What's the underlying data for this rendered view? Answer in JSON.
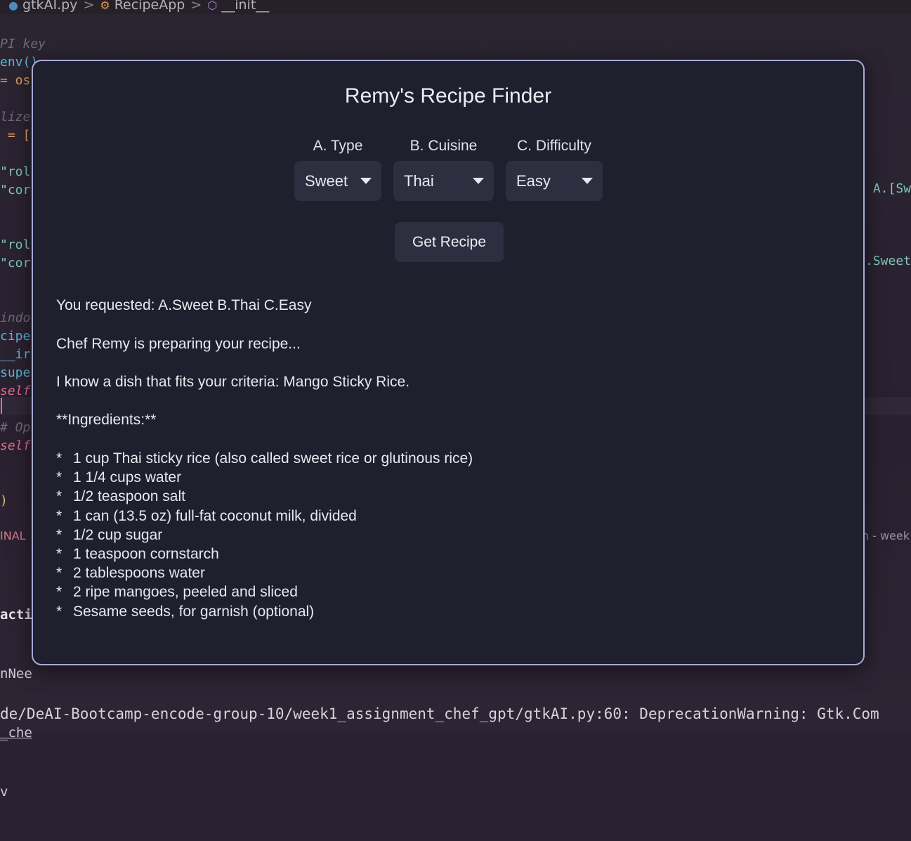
{
  "editor": {
    "breadcrumb": [
      "gtkAI.py",
      "RecipeApp",
      "__init__"
    ],
    "code_lines": [
      {
        "text": "PI key",
        "cls": "c-comment"
      },
      {
        "text": "env()",
        "cls": "c-fn"
      },
      {
        "text": "= os",
        "cls": "c-op"
      },
      {
        "text": "",
        "cls": ""
      },
      {
        "text": "lize",
        "cls": "c-comment"
      },
      {
        "text": " = [",
        "cls": "c-op"
      },
      {
        "text": "",
        "cls": ""
      },
      {
        "text": "\"rol",
        "cls": "c-str"
      },
      {
        "text": "\"cor",
        "cls": "c-str"
      },
      {
        "text": "",
        "cls": ""
      },
      {
        "text": "",
        "cls": ""
      },
      {
        "text": "\"rol",
        "cls": "c-str"
      },
      {
        "text": "\"cor",
        "cls": "c-str"
      },
      {
        "text": "",
        "cls": ""
      },
      {
        "text": "",
        "cls": ""
      },
      {
        "text": "indo",
        "cls": "c-comment"
      },
      {
        "text": "cipe",
        "cls": "c-fn"
      },
      {
        "text": "__ir",
        "cls": "c-fn"
      },
      {
        "text": "supe",
        "cls": "c-fn"
      },
      {
        "text": "self",
        "cls": "c-self"
      },
      {
        "text": "",
        "cls": ""
      },
      {
        "text": "# Op",
        "cls": "c-comment"
      },
      {
        "text": "self",
        "cls": "c-self"
      },
      {
        "text": "",
        "cls": ""
      },
      {
        "text": "",
        "cls": ""
      },
      {
        "text": ")",
        "cls": "c-paren"
      }
    ],
    "right_code_1": "A.[Sw",
    "right_code_2": ".Sweet",
    "panel_label": "INAL",
    "panel_right": "h - week",
    "terminal_lines": [
      "acti",
      "nNee",
      "_che",
      "v"
    ],
    "status_line": "de/DeAI-Bootcamp-encode-group-10/week1_assignment_chef_gpt/gtkAI.py:60: DeprecationWarning: Gtk.Com"
  },
  "dialog": {
    "title": "Remy's Recipe Finder",
    "type": {
      "label": "A. Type",
      "value": "Sweet"
    },
    "cuisine": {
      "label": "B. Cuisine",
      "value": "Thai"
    },
    "difficulty": {
      "label": "C. Difficulty",
      "value": "Easy"
    },
    "button": "Get Recipe",
    "output": {
      "requested": "You requested: A.Sweet B.Thai C.Easy",
      "preparing": "Chef Remy is preparing your recipe...",
      "dish": "I know a dish that fits your criteria: Mango Sticky Rice.",
      "ingredients_header": "**Ingredients:**",
      "bullet": "*",
      "ingredients": [
        "1 cup Thai sticky rice (also called sweet rice or glutinous rice)",
        "1 1/4 cups water",
        "1/2 teaspoon salt",
        "1 can (13.5 oz) full-fat coconut milk, divided",
        "1/2 cup sugar",
        "1 teaspoon cornstarch",
        "2 tablespoons water",
        "2 ripe mangoes, peeled and sliced",
        "Sesame seeds, for garnish (optional)"
      ]
    }
  }
}
